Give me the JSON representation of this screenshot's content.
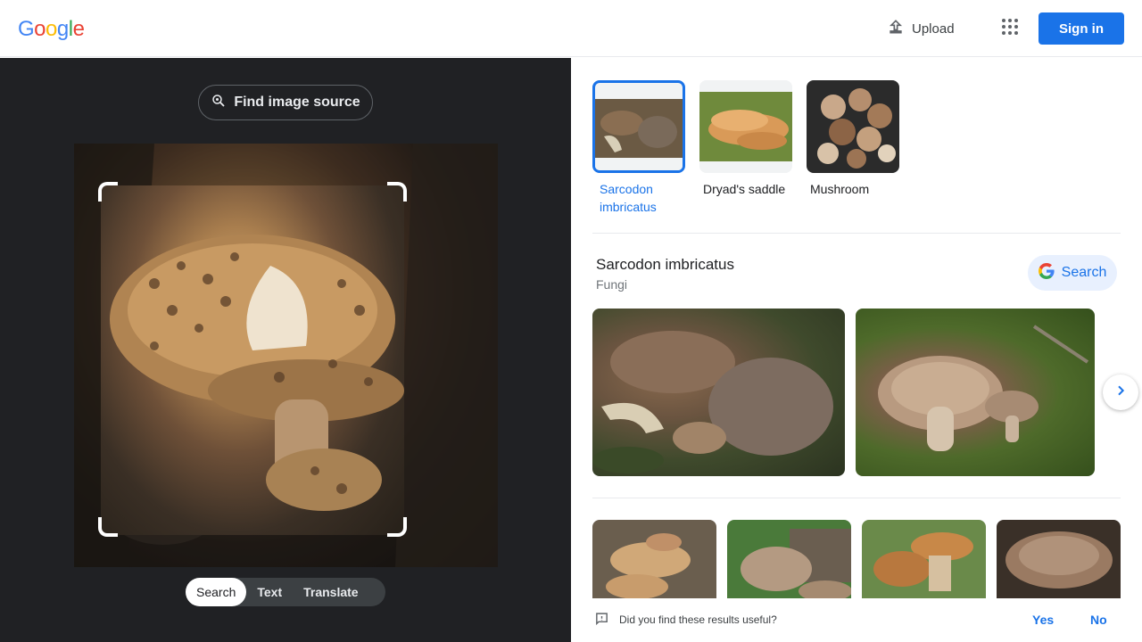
{
  "header": {
    "logo_letters": [
      {
        "ch": "G",
        "color": "#4285f4"
      },
      {
        "ch": "o",
        "color": "#ea4335"
      },
      {
        "ch": "o",
        "color": "#fbbc05"
      },
      {
        "ch": "g",
        "color": "#4285f4"
      },
      {
        "ch": "l",
        "color": "#34a853"
      },
      {
        "ch": "e",
        "color": "#ea4335"
      }
    ],
    "upload_label": "Upload",
    "apps_icon": "apps-grid-icon",
    "signin_label": "Sign in"
  },
  "left_panel": {
    "find_source_label": "Find image source",
    "modes": [
      "Search",
      "Text",
      "Translate"
    ],
    "active_mode": "Search"
  },
  "right_panel": {
    "thumbnails": [
      {
        "label": "Sarcodon imbricatus",
        "active": true
      },
      {
        "label": "Dryad's saddle",
        "active": false
      },
      {
        "label": "Mushroom",
        "active": false
      }
    ],
    "entity": {
      "title": "Sarcodon imbricatus",
      "subtitle": "Fungi",
      "search_label": "Search"
    },
    "feedback": {
      "question": "Did you find these results useful?",
      "yes": "Yes",
      "no": "No"
    }
  },
  "colors": {
    "accent": "#1a73e8",
    "dark_panel": "#202124"
  }
}
